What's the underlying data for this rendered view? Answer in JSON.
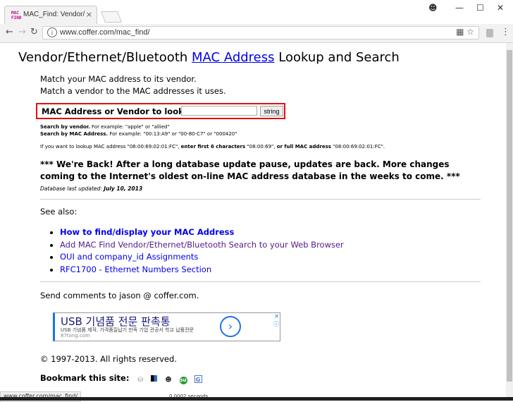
{
  "browser": {
    "tab_title": "MAC_Find: Vendor/Ethe",
    "tab_favicon_text": "MAC FIND",
    "tab_close": "×",
    "url": "www.coffer.com/mac_find/",
    "window_controls": [
      "profile-icon",
      "minimize",
      "maximize",
      "close"
    ]
  },
  "page": {
    "heading_before": "Vendor/Ethernet/Bluetooth ",
    "heading_link": "MAC Address",
    "heading_after": " Lookup and Search",
    "intro_1": "Match your MAC address to its vendor.",
    "intro_2": "Match a vendor to the MAC addresses it uses.",
    "search_label": "MAC Address or Vendor to look for:",
    "search_value": "",
    "search_button": "string",
    "help_vendor_bold": "Search by vendor.",
    "help_vendor_text": " For example: \"apple\" or \"allied\"",
    "help_mac_bold": "Search by MAC Address.",
    "help_mac_text": " For example: \"00:13:A9\" or \"00-80-C7\" or \"000420\"",
    "lookup_1": "If you want to lookup MAC address \"08:00:69:02:01:FC\", ",
    "lookup_2": "enter first 6 characters",
    "lookup_3": " \"08:00:69\", ",
    "lookup_4": "or full MAC address",
    "lookup_5": " \"08:00:69:02:01:FC\".",
    "notice": "*** We're Back! After a long database update pause, updates are back. More changes coming to the Internet's oldest on-line MAC address database in the weeks to come. ***",
    "updated_label": "Database last updated: ",
    "updated_date": "July 10, 2013",
    "see_also": "See also:",
    "links": [
      {
        "label": "How to find/display your MAC Address",
        "bold": true,
        "visited": false
      },
      {
        "label": "Add MAC Find Vendor/Ethernet/Bluetooth Search to your Web Browser",
        "bold": false,
        "visited": true
      },
      {
        "label": "OUI and company_id Assignments",
        "bold": false,
        "visited": false
      },
      {
        "label": "RFC1700 - Ethernet Numbers Section",
        "bold": false,
        "visited": false
      }
    ],
    "comments": "Send comments to jason @ coffer.com.",
    "copyright": "© 1997-2013. All rights reserved.",
    "bookmark_label": "Bookmark this site:",
    "bookmark_icons": [
      "delicious-icon",
      "digg-icon",
      "reddit-icon",
      "stumbleupon-icon",
      "google-icon"
    ]
  },
  "ad": {
    "title": "USB 기념품 전문 판촉통",
    "subtitle": "USB 기념품 제작, 가격품질납기 만족 기업 관공서 학교 납품전문",
    "url": "87tong.com",
    "arrow": "›",
    "close": "✕",
    "info": "ⓘ"
  },
  "status": {
    "url": "www.coffer.com/mac_find/",
    "seconds": "0.0002 seconds"
  },
  "colors": {
    "link": "#0000ee",
    "visited": "#551a8b",
    "highlight": "#e01010"
  }
}
